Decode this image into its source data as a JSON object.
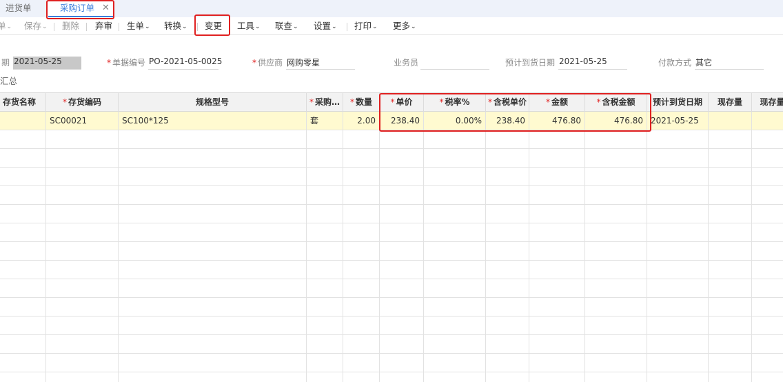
{
  "tabs": [
    {
      "label": "进货单",
      "active": false
    },
    {
      "label": "采购订单",
      "active": true,
      "close_icon": "close-icon"
    }
  ],
  "toolbar": {
    "partial_first": "单",
    "save": "保存",
    "delete": "删除",
    "abandon": "弃审",
    "generate": "生单",
    "convert": "转换",
    "change": "变更",
    "tools": "工具",
    "linked_query": "联查",
    "settings": "设置",
    "print": "打印",
    "more": "更多"
  },
  "form": {
    "date_label": "期",
    "date_value": "2021-05-25",
    "doc_no_label": "单据编号",
    "doc_no_value": "PO-2021-05-0025",
    "supplier_label": "供应商",
    "supplier_value": "网购零星",
    "clerk_label": "业务员",
    "clerk_value": "",
    "arrival_label": "预计到货日期",
    "arrival_value": "2021-05-25",
    "payment_label": "付款方式",
    "payment_value": "其它",
    "summary_label": "汇总"
  },
  "grid": {
    "columns": [
      {
        "label": "存货名称",
        "required": false
      },
      {
        "label": "存货编码",
        "required": true
      },
      {
        "label": "规格型号",
        "required": false
      },
      {
        "label": "采购…",
        "required": true
      },
      {
        "label": "数量",
        "required": true
      },
      {
        "label": "单价",
        "required": true
      },
      {
        "label": "税率%",
        "required": true
      },
      {
        "label": "含税单价",
        "required": true
      },
      {
        "label": "金额",
        "required": true
      },
      {
        "label": "含税金额",
        "required": true
      },
      {
        "label": "预计到货日期",
        "required": false
      },
      {
        "label": "现存量",
        "required": false
      },
      {
        "label": "现存量",
        "required": false
      }
    ],
    "rows": [
      [
        "",
        "SC00021",
        "SC100*125",
        "套",
        "2.00",
        "238.40",
        "0.00%",
        "238.40",
        "476.80",
        "476.80",
        "2021-05-25",
        "",
        ""
      ]
    ]
  },
  "colors": {
    "accent": "#3a7ddb",
    "highlight": "#e02020",
    "selected_row": "#fffad0",
    "tabbar_bg": "#eef2fa"
  }
}
